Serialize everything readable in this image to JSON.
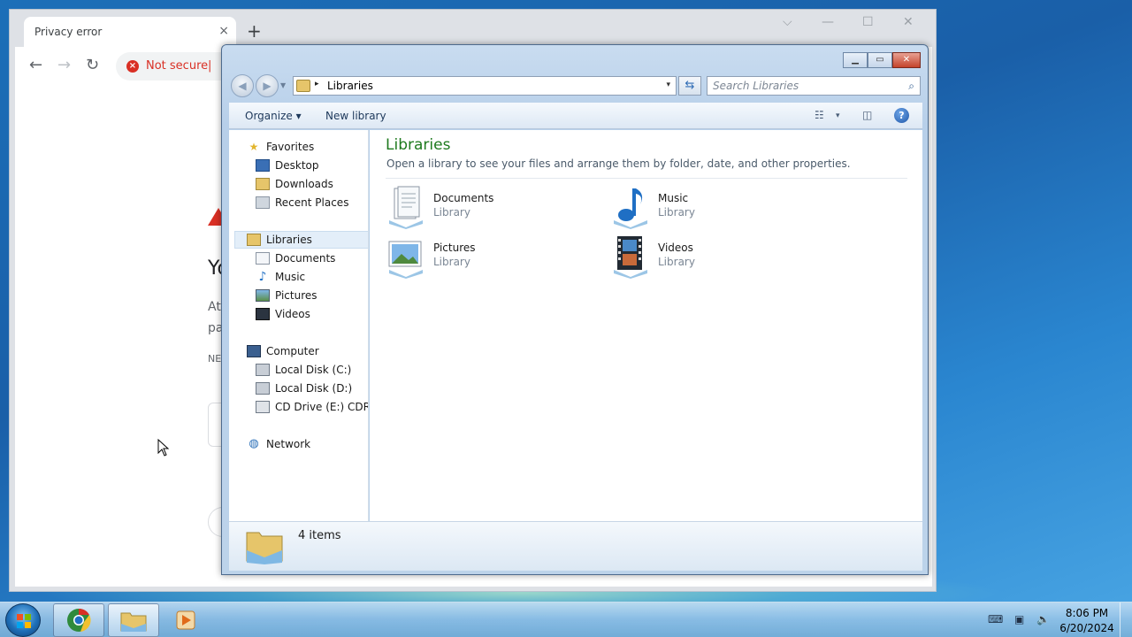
{
  "browser": {
    "tab_title": "Privacy error",
    "tab_close": "×",
    "new_tab": "+",
    "back": "←",
    "forward": "→",
    "reload": "↻",
    "security_label": "Not secure",
    "security_sep": "|",
    "window_ctrls": {
      "dropdown": "⌵",
      "minimize": "—",
      "maximize": "☐",
      "close": "✕"
    },
    "page_fragments": {
      "heading": "Yo",
      "line1": "At",
      "line2": "pa",
      "code": "NE"
    }
  },
  "explorer": {
    "window_ctrls": {
      "minimize": "▁",
      "maximize": "▭",
      "close": "✕"
    },
    "address": {
      "current": "Libraries",
      "dropdown": "▾",
      "arrow": "▸"
    },
    "refresh": "⇆",
    "search": {
      "placeholder": "Search Libraries",
      "icon": "⌕"
    },
    "commands": {
      "organize": "Organize",
      "organize_dd": "▾",
      "new_library": "New library",
      "views_dd": "▾",
      "help": "?"
    },
    "nav": {
      "favorites": {
        "label": "Favorites",
        "items": [
          "Desktop",
          "Downloads",
          "Recent Places"
        ]
      },
      "libraries": {
        "label": "Libraries",
        "items": [
          "Documents",
          "Music",
          "Pictures",
          "Videos"
        ]
      },
      "computer": {
        "label": "Computer",
        "items": [
          "Local Disk (C:)",
          "Local Disk (D:)",
          "CD Drive (E:) CDROM"
        ]
      },
      "network": {
        "label": "Network"
      }
    },
    "content": {
      "heading": "Libraries",
      "description": "Open a library to see your files and arrange them by folder, date, and other properties.",
      "items": [
        {
          "name": "Documents",
          "type": "Library"
        },
        {
          "name": "Music",
          "type": "Library"
        },
        {
          "name": "Pictures",
          "type": "Library"
        },
        {
          "name": "Videos",
          "type": "Library"
        }
      ]
    },
    "details": {
      "count": "4 items"
    }
  },
  "taskbar": {
    "time": "8:06 PM",
    "date": "6/20/2024",
    "tray_icons": [
      "keyboard-icon",
      "network-icon",
      "volume-muted-icon"
    ]
  },
  "colors": {
    "heading_green": "#1e7a1e",
    "not_secure_red": "#d93025",
    "desktop_blue": "#1a5fa8"
  }
}
